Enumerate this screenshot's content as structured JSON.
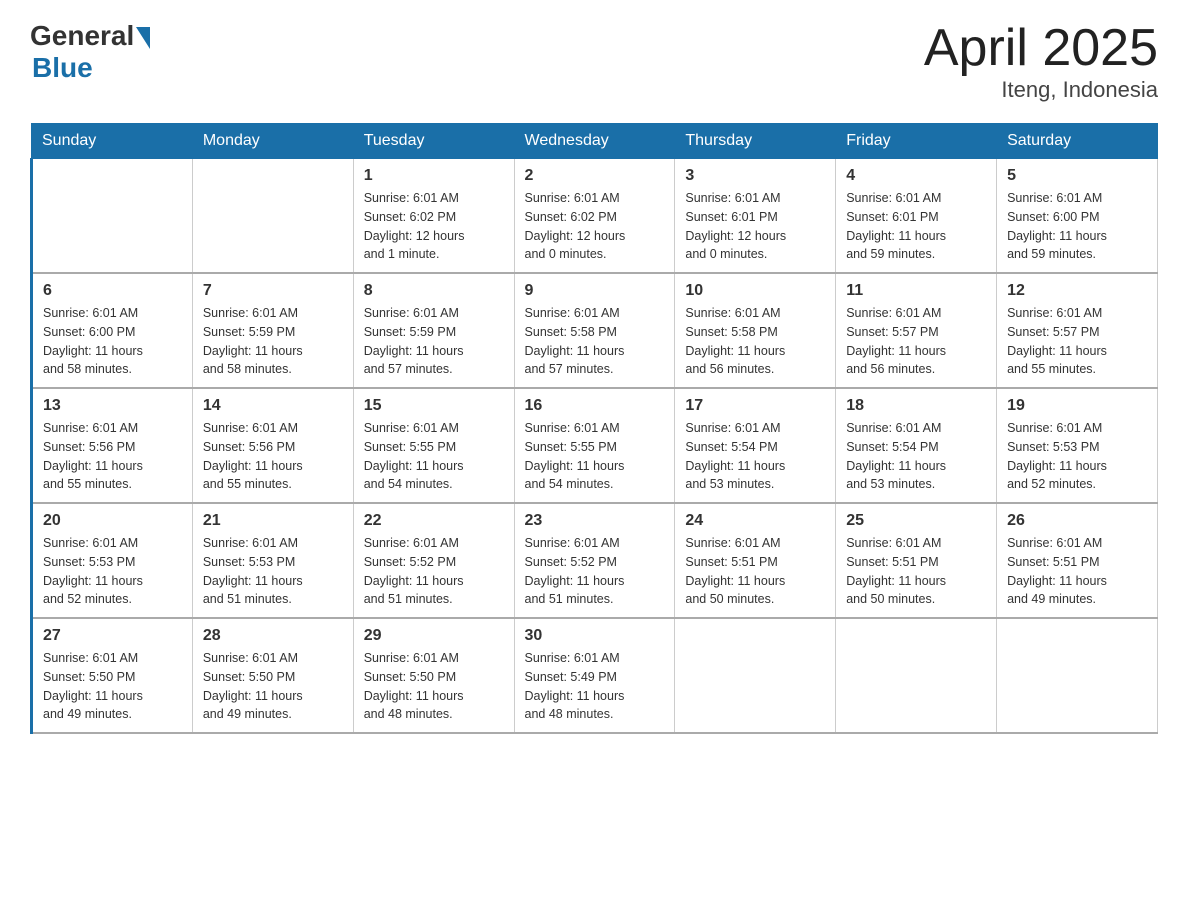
{
  "logo": {
    "general": "General",
    "blue": "Blue",
    "sub": "Blue"
  },
  "title": "April 2025",
  "subtitle": "Iteng, Indonesia",
  "weekdays": [
    "Sunday",
    "Monday",
    "Tuesday",
    "Wednesday",
    "Thursday",
    "Friday",
    "Saturday"
  ],
  "weeks": [
    [
      {
        "day": "",
        "info": ""
      },
      {
        "day": "",
        "info": ""
      },
      {
        "day": "1",
        "info": "Sunrise: 6:01 AM\nSunset: 6:02 PM\nDaylight: 12 hours\nand 1 minute."
      },
      {
        "day": "2",
        "info": "Sunrise: 6:01 AM\nSunset: 6:02 PM\nDaylight: 12 hours\nand 0 minutes."
      },
      {
        "day": "3",
        "info": "Sunrise: 6:01 AM\nSunset: 6:01 PM\nDaylight: 12 hours\nand 0 minutes."
      },
      {
        "day": "4",
        "info": "Sunrise: 6:01 AM\nSunset: 6:01 PM\nDaylight: 11 hours\nand 59 minutes."
      },
      {
        "day": "5",
        "info": "Sunrise: 6:01 AM\nSunset: 6:00 PM\nDaylight: 11 hours\nand 59 minutes."
      }
    ],
    [
      {
        "day": "6",
        "info": "Sunrise: 6:01 AM\nSunset: 6:00 PM\nDaylight: 11 hours\nand 58 minutes."
      },
      {
        "day": "7",
        "info": "Sunrise: 6:01 AM\nSunset: 5:59 PM\nDaylight: 11 hours\nand 58 minutes."
      },
      {
        "day": "8",
        "info": "Sunrise: 6:01 AM\nSunset: 5:59 PM\nDaylight: 11 hours\nand 57 minutes."
      },
      {
        "day": "9",
        "info": "Sunrise: 6:01 AM\nSunset: 5:58 PM\nDaylight: 11 hours\nand 57 minutes."
      },
      {
        "day": "10",
        "info": "Sunrise: 6:01 AM\nSunset: 5:58 PM\nDaylight: 11 hours\nand 56 minutes."
      },
      {
        "day": "11",
        "info": "Sunrise: 6:01 AM\nSunset: 5:57 PM\nDaylight: 11 hours\nand 56 minutes."
      },
      {
        "day": "12",
        "info": "Sunrise: 6:01 AM\nSunset: 5:57 PM\nDaylight: 11 hours\nand 55 minutes."
      }
    ],
    [
      {
        "day": "13",
        "info": "Sunrise: 6:01 AM\nSunset: 5:56 PM\nDaylight: 11 hours\nand 55 minutes."
      },
      {
        "day": "14",
        "info": "Sunrise: 6:01 AM\nSunset: 5:56 PM\nDaylight: 11 hours\nand 55 minutes."
      },
      {
        "day": "15",
        "info": "Sunrise: 6:01 AM\nSunset: 5:55 PM\nDaylight: 11 hours\nand 54 minutes."
      },
      {
        "day": "16",
        "info": "Sunrise: 6:01 AM\nSunset: 5:55 PM\nDaylight: 11 hours\nand 54 minutes."
      },
      {
        "day": "17",
        "info": "Sunrise: 6:01 AM\nSunset: 5:54 PM\nDaylight: 11 hours\nand 53 minutes."
      },
      {
        "day": "18",
        "info": "Sunrise: 6:01 AM\nSunset: 5:54 PM\nDaylight: 11 hours\nand 53 minutes."
      },
      {
        "day": "19",
        "info": "Sunrise: 6:01 AM\nSunset: 5:53 PM\nDaylight: 11 hours\nand 52 minutes."
      }
    ],
    [
      {
        "day": "20",
        "info": "Sunrise: 6:01 AM\nSunset: 5:53 PM\nDaylight: 11 hours\nand 52 minutes."
      },
      {
        "day": "21",
        "info": "Sunrise: 6:01 AM\nSunset: 5:53 PM\nDaylight: 11 hours\nand 51 minutes."
      },
      {
        "day": "22",
        "info": "Sunrise: 6:01 AM\nSunset: 5:52 PM\nDaylight: 11 hours\nand 51 minutes."
      },
      {
        "day": "23",
        "info": "Sunrise: 6:01 AM\nSunset: 5:52 PM\nDaylight: 11 hours\nand 51 minutes."
      },
      {
        "day": "24",
        "info": "Sunrise: 6:01 AM\nSunset: 5:51 PM\nDaylight: 11 hours\nand 50 minutes."
      },
      {
        "day": "25",
        "info": "Sunrise: 6:01 AM\nSunset: 5:51 PM\nDaylight: 11 hours\nand 50 minutes."
      },
      {
        "day": "26",
        "info": "Sunrise: 6:01 AM\nSunset: 5:51 PM\nDaylight: 11 hours\nand 49 minutes."
      }
    ],
    [
      {
        "day": "27",
        "info": "Sunrise: 6:01 AM\nSunset: 5:50 PM\nDaylight: 11 hours\nand 49 minutes."
      },
      {
        "day": "28",
        "info": "Sunrise: 6:01 AM\nSunset: 5:50 PM\nDaylight: 11 hours\nand 49 minutes."
      },
      {
        "day": "29",
        "info": "Sunrise: 6:01 AM\nSunset: 5:50 PM\nDaylight: 11 hours\nand 48 minutes."
      },
      {
        "day": "30",
        "info": "Sunrise: 6:01 AM\nSunset: 5:49 PM\nDaylight: 11 hours\nand 48 minutes."
      },
      {
        "day": "",
        "info": ""
      },
      {
        "day": "",
        "info": ""
      },
      {
        "day": "",
        "info": ""
      }
    ]
  ]
}
